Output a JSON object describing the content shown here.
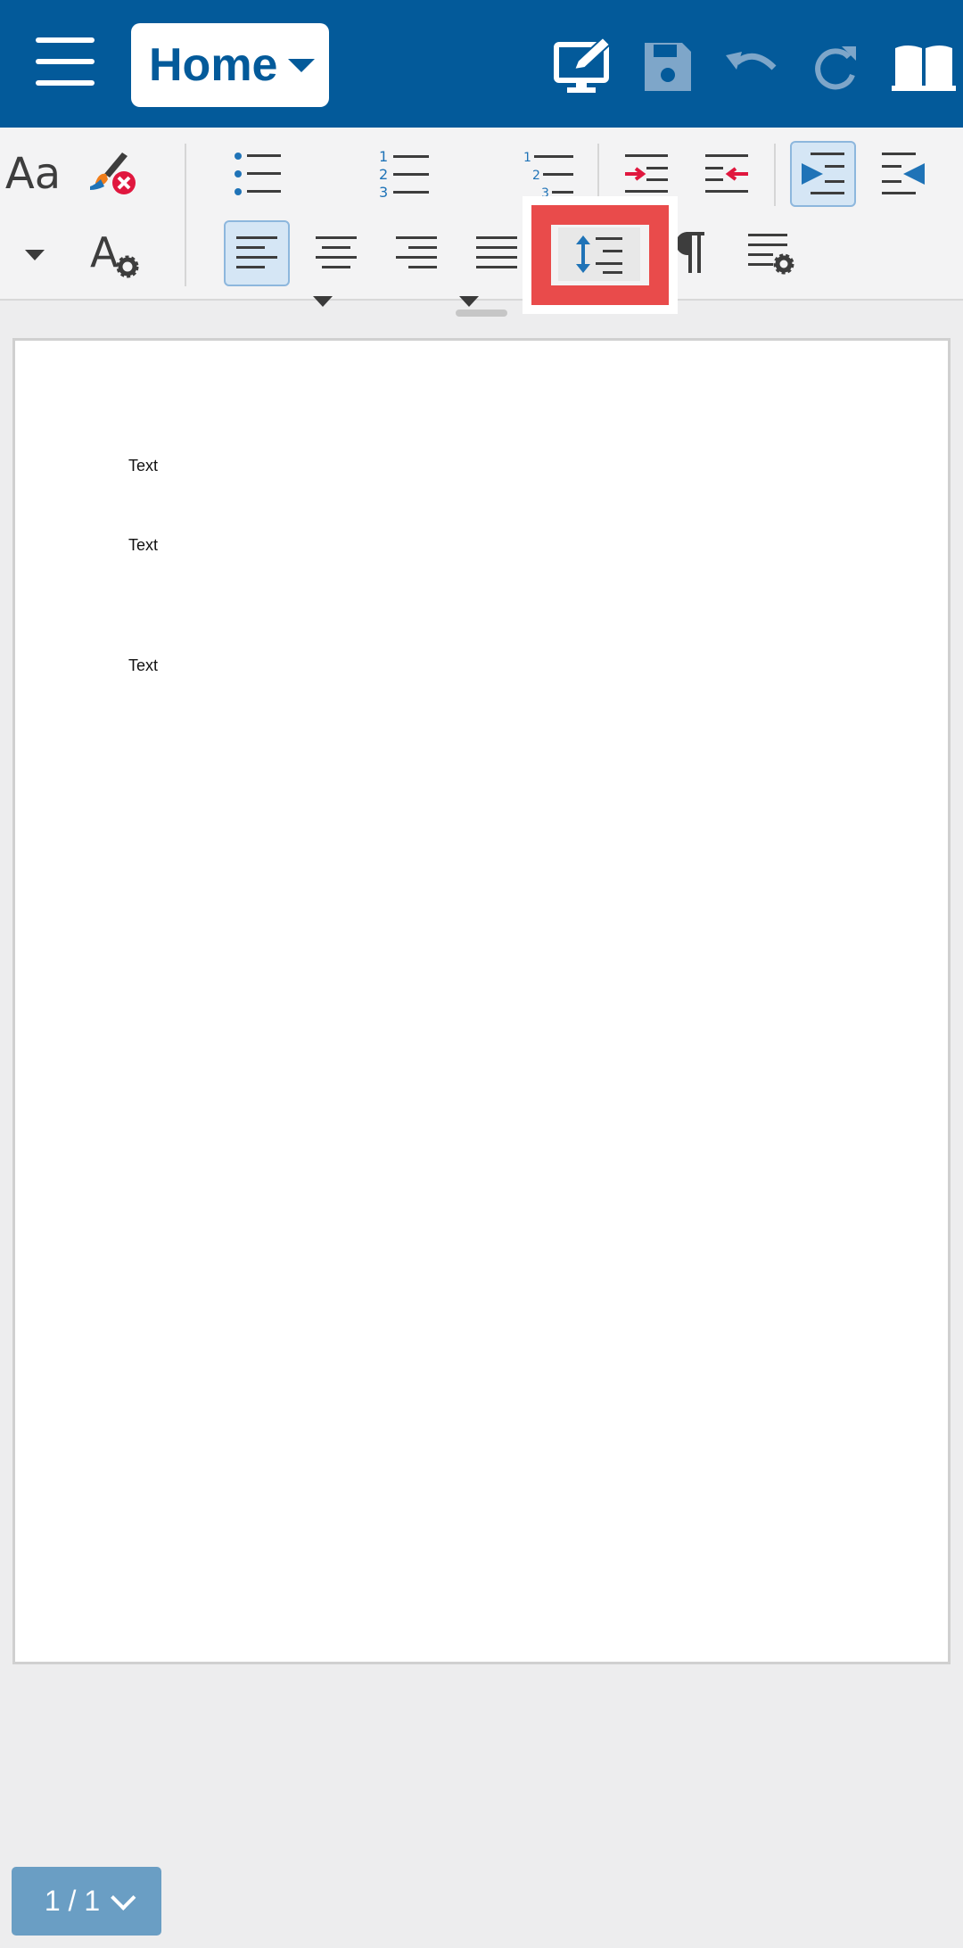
{
  "header": {
    "tab_label": "Home",
    "icons": [
      "menu-icon",
      "edit-mode-icon",
      "save-icon",
      "undo-icon",
      "redo-icon",
      "read-mode-icon"
    ]
  },
  "toolbar": {
    "font_label": "Aa",
    "row1": [
      "font-style-icon",
      "clear-formatting-icon",
      "bullet-list-icon",
      "numbered-list-icon",
      "multilevel-list-icon",
      "increase-indent-icon",
      "decrease-indent-icon",
      "ltr-icon",
      "rtl-icon"
    ],
    "row2": [
      "font-settings-icon",
      "align-left-icon",
      "align-center-icon",
      "align-right-icon",
      "justify-icon",
      "line-spacing-icon",
      "paragraph-marks-icon",
      "paragraph-settings-icon"
    ],
    "highlighted": "line-spacing-icon"
  },
  "document": {
    "lines": [
      "Text",
      "Text",
      "Text"
    ]
  },
  "pager": {
    "label": "1 / 1"
  },
  "colors": {
    "brand": "#035a9a",
    "highlight": "#e94b4b",
    "accent_blue": "#1f73b7",
    "accent_red": "#e0173e"
  }
}
